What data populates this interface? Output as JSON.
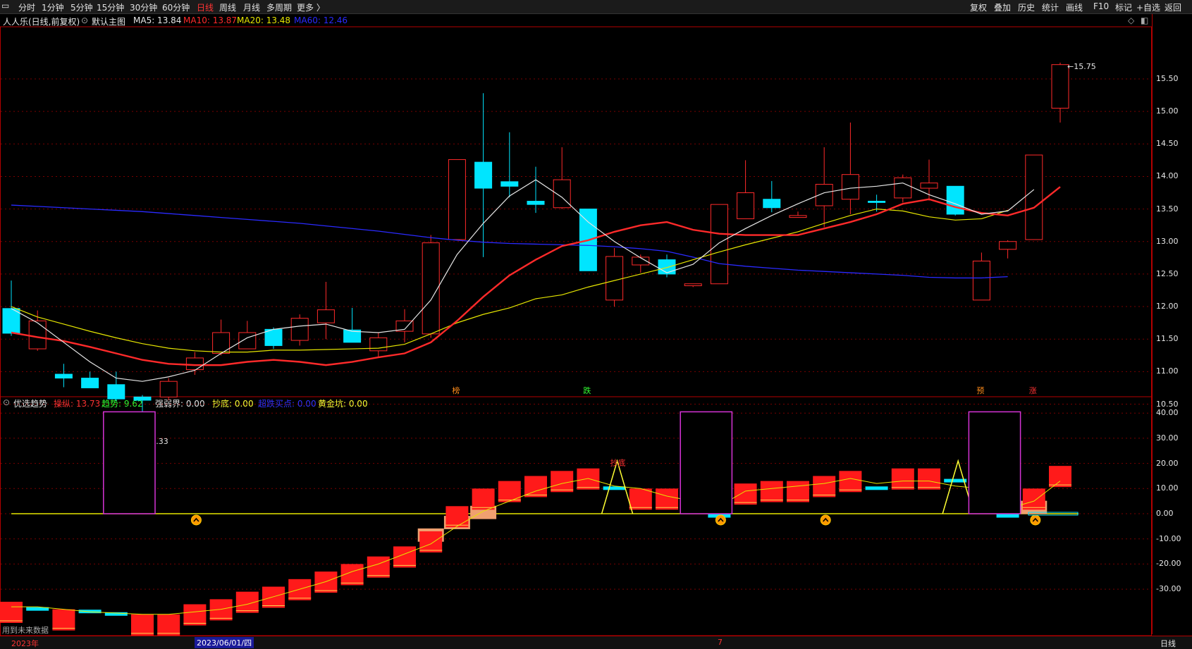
{
  "toolbar": {
    "periods": [
      "分时",
      "1分钟",
      "5分钟",
      "15分钟",
      "30分钟",
      "60分钟",
      "日线",
      "周线",
      "月线",
      "多周期",
      "更多 〉"
    ],
    "active_period": "日线",
    "right_items": [
      "复权",
      "叠加",
      "历史",
      "统计",
      "画线",
      "F10",
      "标记",
      "+自选",
      "返回"
    ]
  },
  "main_chart": {
    "stock_title": "人人乐(日线,前复权)",
    "template": "默认主图",
    "ma_labels": [
      {
        "text": "MA5: 13.84",
        "color": "#e6e6e6"
      },
      {
        "text": "MA10: 13.87",
        "color": "#ff2a2a"
      },
      {
        "text": "MA20: 13.48",
        "color": "#e6e600"
      },
      {
        "text": "MA60: 12.46",
        "color": "#2a2aff"
      }
    ],
    "high_label": "15.75",
    "low_label": "10.33",
    "y_ticks": [
      "15.50",
      "15.00",
      "14.50",
      "14.00",
      "13.50",
      "13.00",
      "12.50",
      "12.00",
      "11.50",
      "11.00",
      "10.50"
    ],
    "markers": [
      {
        "text": "榜",
        "color": "#ff8c1a"
      },
      {
        "text": "跌",
        "color": "#33ff33"
      },
      {
        "text": "预",
        "color": "#ff8c1a"
      },
      {
        "text": "涨",
        "color": "#ff3333"
      }
    ],
    "candles": [
      [
        11.97,
        11.59,
        12.4,
        11.55
      ],
      [
        11.35,
        11.78,
        11.94,
        11.32
      ],
      [
        10.96,
        10.9,
        11.12,
        10.76
      ],
      [
        10.9,
        10.75,
        11.0,
        10.75
      ],
      [
        10.8,
        10.58,
        11.0,
        10.55
      ],
      [
        10.61,
        10.56,
        10.64,
        10.33
      ],
      [
        10.61,
        10.85,
        10.9,
        10.56
      ],
      [
        11.03,
        11.21,
        11.3,
        10.95
      ],
      [
        11.28,
        11.6,
        11.8,
        11.25
      ],
      [
        11.35,
        11.6,
        11.78,
        11.35
      ],
      [
        11.65,
        11.4,
        11.68,
        11.35
      ],
      [
        11.48,
        11.82,
        11.88,
        11.4
      ],
      [
        11.75,
        11.95,
        12.38,
        11.5
      ],
      [
        11.64,
        11.45,
        11.98,
        11.45
      ],
      [
        11.32,
        11.52,
        11.6,
        11.22
      ],
      [
        11.62,
        11.78,
        11.96,
        11.45
      ],
      [
        11.58,
        12.98,
        13.1,
        11.52
      ],
      [
        13.03,
        14.26,
        14.26,
        13.03
      ],
      [
        14.22,
        13.82,
        15.28,
        12.76
      ],
      [
        13.92,
        13.85,
        14.68,
        13.68
      ],
      [
        13.62,
        13.57,
        14.15,
        13.44
      ],
      [
        13.52,
        13.95,
        14.45,
        13.5
      ],
      [
        13.5,
        12.55,
        13.5,
        12.55
      ],
      [
        12.1,
        12.77,
        12.9,
        12.0
      ],
      [
        12.64,
        12.76,
        12.8,
        12.52
      ],
      [
        12.72,
        12.5,
        12.8,
        12.45
      ],
      [
        12.32,
        12.35,
        12.33,
        12.3
      ],
      [
        12.35,
        13.57,
        13.57,
        12.35
      ],
      [
        13.35,
        13.75,
        14.25,
        13.35
      ],
      [
        13.65,
        13.52,
        13.93,
        13.45
      ],
      [
        13.37,
        13.4,
        13.46,
        13.37
      ],
      [
        13.55,
        13.88,
        14.45,
        13.22
      ],
      [
        13.65,
        14.03,
        14.83,
        13.42
      ],
      [
        13.62,
        13.6,
        13.72,
        13.46
      ],
      [
        13.67,
        13.98,
        14.03,
        13.6
      ],
      [
        13.82,
        13.9,
        14.26,
        13.63
      ],
      [
        13.85,
        13.42,
        13.85,
        13.4
      ],
      [
        12.1,
        12.7,
        12.83,
        12.1
      ],
      [
        12.88,
        13.0,
        13.02,
        12.74
      ],
      [
        13.03,
        14.33,
        14.33,
        13.03
      ],
      [
        15.05,
        15.72,
        15.75,
        14.83
      ]
    ],
    "ma5": [
      11.97,
      11.75,
      11.45,
      11.15,
      10.9,
      10.85,
      10.92,
      11.02,
      11.28,
      11.52,
      11.65,
      11.7,
      11.73,
      11.62,
      11.6,
      11.65,
      12.1,
      12.8,
      13.28,
      13.7,
      13.95,
      13.68,
      13.3,
      13.0,
      12.75,
      12.52,
      12.65,
      12.98,
      13.2,
      13.4,
      13.58,
      13.75,
      13.82,
      13.85,
      13.9,
      13.72,
      13.58,
      13.42,
      13.47,
      13.8
    ],
    "ma10": [
      11.6,
      11.53,
      11.47,
      11.38,
      11.28,
      11.18,
      11.12,
      11.1,
      11.1,
      11.15,
      11.18,
      11.15,
      11.1,
      11.15,
      11.22,
      11.28,
      11.45,
      11.78,
      12.15,
      12.48,
      12.72,
      12.93,
      13.02,
      13.15,
      13.25,
      13.3,
      13.18,
      13.12,
      13.1,
      13.1,
      13.1,
      13.2,
      13.3,
      13.42,
      13.58,
      13.65,
      13.53,
      13.44,
      13.4,
      13.52,
      13.84
    ],
    "ma20": [
      12.0,
      11.84,
      11.73,
      11.62,
      11.52,
      11.43,
      11.36,
      11.32,
      11.3,
      11.3,
      11.33,
      11.33,
      11.34,
      11.35,
      11.36,
      11.42,
      11.58,
      11.75,
      11.88,
      11.98,
      12.12,
      12.18,
      12.3,
      12.4,
      12.5,
      12.6,
      12.72,
      12.84,
      12.95,
      13.05,
      13.15,
      13.28,
      13.4,
      13.5,
      13.47,
      13.38,
      13.33,
      13.35,
      13.48
    ],
    "ma60": [
      13.56,
      13.54,
      13.52,
      13.5,
      13.48,
      13.46,
      13.43,
      13.4,
      13.37,
      13.34,
      13.31,
      13.28,
      13.24,
      13.2,
      13.16,
      13.11,
      13.06,
      13.02,
      12.99,
      12.97,
      12.96,
      12.95,
      12.94,
      12.92,
      12.89,
      12.85,
      12.76,
      12.66,
      12.62,
      12.59,
      12.56,
      12.54,
      12.52,
      12.5,
      12.48,
      12.45,
      12.44,
      12.44,
      12.46
    ]
  },
  "indicator": {
    "title": "优选趋势",
    "labels": [
      {
        "text": "操纵: 13.73",
        "color": "#ff3333"
      },
      {
        "text": "趋势: 9.62",
        "color": "#33ff33"
      },
      {
        "text": "强弱界: 0.00",
        "color": "#e6e6e6"
      },
      {
        "text": "抄底: 0.00",
        "color": "#ffff33"
      },
      {
        "text": "超跌买点: 0.00",
        "color": "#3333ff"
      },
      {
        "text": "黄金坑: 0.00",
        "color": "#ffff33"
      }
    ],
    "chaodi_text": "抄底",
    "y_ticks": [
      "40.00",
      "30.00",
      "20.00",
      "10.00",
      "0.00",
      "-10.00",
      "-20.00",
      "-30.00"
    ],
    "warning": "用到未来数据",
    "bars": [
      -35,
      -38,
      -38,
      -39,
      -40,
      -40,
      -40,
      -36,
      -34,
      -31,
      -29,
      -26,
      -23,
      -20,
      -17,
      -13,
      -7,
      3,
      10,
      13,
      15,
      17,
      18,
      10,
      10,
      10,
      8,
      -1,
      12,
      13,
      13,
      15,
      17,
      10,
      18,
      18,
      13,
      12,
      -1,
      10,
      19
    ],
    "trend": [
      -37,
      -37,
      -38,
      -39,
      -39.5,
      -40,
      -40,
      -39,
      -38,
      -36,
      -33,
      -30,
      -27,
      -23,
      -20,
      -16,
      -12,
      -5,
      1,
      5,
      9,
      12,
      14,
      11,
      10,
      7,
      5,
      3,
      9,
      10,
      11,
      12,
      14,
      12,
      13,
      13,
      11,
      10,
      2,
      5,
      13
    ],
    "spikes_magenta": [
      [
        4,
        5
      ],
      [
        26,
        27
      ],
      [
        37,
        38
      ]
    ],
    "orange_bars": [
      [
        16,
        -11
      ],
      [
        17,
        -6
      ],
      [
        18,
        -2
      ],
      [
        39,
        5
      ]
    ],
    "chaodi_peaks": [
      23,
      36
    ],
    "up_arrows": [
      7,
      27,
      31,
      39
    ]
  },
  "bottom": {
    "year": "2023年",
    "date": "2023/06/01/四",
    "mid": "7",
    "period": "日线"
  }
}
